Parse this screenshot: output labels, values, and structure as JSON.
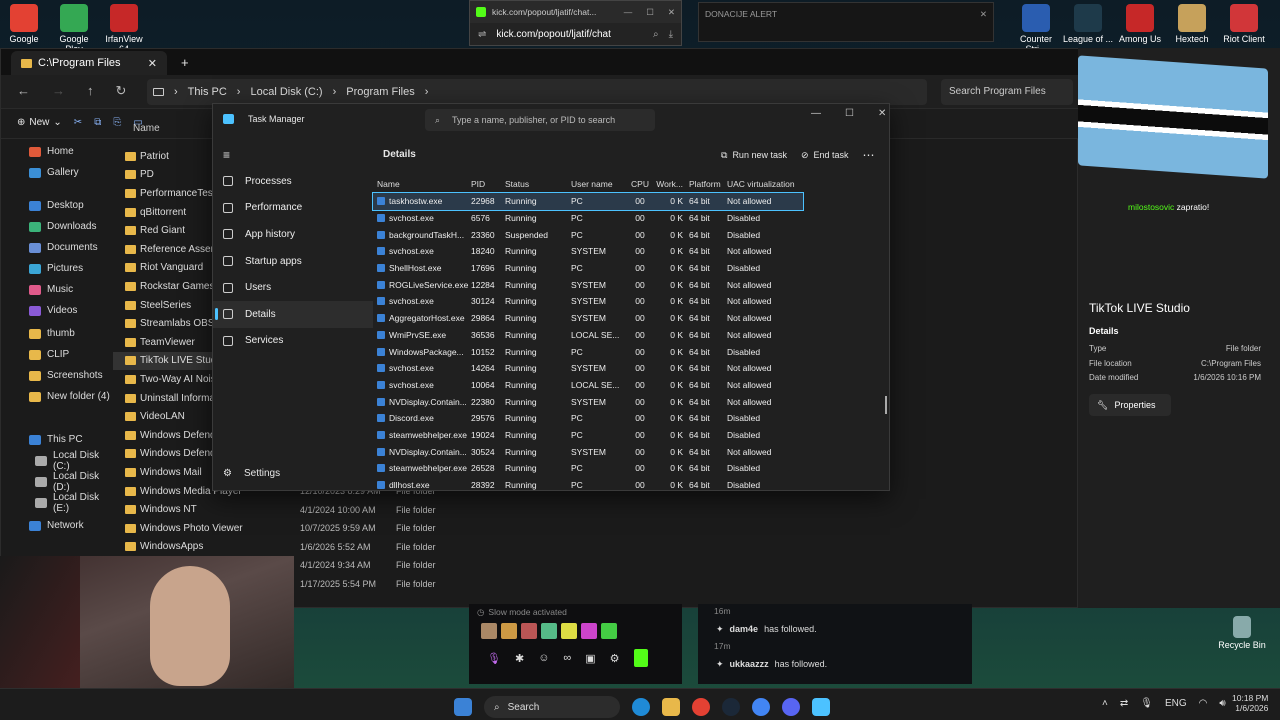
{
  "desktop_icons_left": [
    {
      "label": "Google",
      "color": "#e34133"
    },
    {
      "label": "Google Play",
      "color": "#34a853"
    },
    {
      "label": "IrfanView 64",
      "color": "#c62828"
    }
  ],
  "desktop_icons_right": [
    {
      "label": "Counter Stri...",
      "color": "#2a5db0"
    },
    {
      "label": "League of ...",
      "color": "#1e3a4a"
    },
    {
      "label": "Among Us",
      "color": "#c62828"
    },
    {
      "label": "Hextech",
      "color": "#c6a15b"
    },
    {
      "label": "Riot Client",
      "color": "#d13639"
    }
  ],
  "recycle_bin": {
    "label": "Recycle Bin"
  },
  "chat_popout": {
    "title": "kick.com/popout/ljatif/chat...",
    "url": "kick.com/popout/ljatif/chat"
  },
  "donation_alert": {
    "title": "DONACIJE ALERT"
  },
  "explorer": {
    "tab_title": "C:\\Program Files",
    "breadcrumbs": [
      "This PC",
      "Local Disk (C:)",
      "Program Files"
    ],
    "search_placeholder": "Search Program Files",
    "new_label": "New",
    "column_name": "Name",
    "nav": [
      {
        "label": "Home",
        "color": "#e05a3a"
      },
      {
        "label": "Gallery",
        "color": "#3b8fd6"
      },
      {
        "label": "Desktop",
        "color": "#3b82d6"
      },
      {
        "label": "Downloads",
        "color": "#3bb37a"
      },
      {
        "label": "Documents",
        "color": "#6a8fd6"
      },
      {
        "label": "Pictures",
        "color": "#3ba6d6"
      },
      {
        "label": "Music",
        "color": "#e05a8a"
      },
      {
        "label": "Videos",
        "color": "#8a5ad6"
      },
      {
        "label": "thumb",
        "color": "#e8b84a"
      },
      {
        "label": "CLIP",
        "color": "#e8b84a"
      },
      {
        "label": "Screenshots",
        "color": "#e8b84a"
      },
      {
        "label": "New folder (4)",
        "color": "#e8b84a"
      },
      {
        "label": "This PC",
        "color": "#3b82d6"
      },
      {
        "label": "Local Disk (C:)",
        "color": "#aaaaaa"
      },
      {
        "label": "Local Disk (D:)",
        "color": "#aaaaaa"
      },
      {
        "label": "Local Disk (E:)",
        "color": "#aaaaaa"
      },
      {
        "label": "Network",
        "color": "#3b82d6"
      }
    ],
    "folders": [
      {
        "name": "Patriot",
        "date": "",
        "type": ""
      },
      {
        "name": "PD",
        "date": "",
        "type": ""
      },
      {
        "name": "PerformanceTest",
        "date": "",
        "type": ""
      },
      {
        "name": "qBittorrent",
        "date": "",
        "type": ""
      },
      {
        "name": "Red Giant",
        "date": "",
        "type": ""
      },
      {
        "name": "Reference Assemblie",
        "date": "",
        "type": ""
      },
      {
        "name": "Riot Vanguard",
        "date": "",
        "type": ""
      },
      {
        "name": "Rockstar Games",
        "date": "",
        "type": ""
      },
      {
        "name": "SteelSeries",
        "date": "",
        "type": ""
      },
      {
        "name": "Streamlabs OBS",
        "date": "",
        "type": ""
      },
      {
        "name": "TeamViewer",
        "date": "",
        "type": ""
      },
      {
        "name": "TikTok LIVE Studio",
        "date": "",
        "type": ""
      },
      {
        "name": "Two-Way AI Noise C",
        "date": "",
        "type": ""
      },
      {
        "name": "Uninstall Information",
        "date": "",
        "type": ""
      },
      {
        "name": "VideoLAN",
        "date": "",
        "type": ""
      },
      {
        "name": "Windows Defender",
        "date": "",
        "type": ""
      },
      {
        "name": "Windows Defender A",
        "date": "",
        "type": ""
      },
      {
        "name": "Windows Mail",
        "date": "",
        "type": ""
      },
      {
        "name": "Windows Media Player",
        "date": "12/10/2023 8:29 AM",
        "type": "File folder"
      },
      {
        "name": "Windows NT",
        "date": "4/1/2024 10:00 AM",
        "type": "File folder"
      },
      {
        "name": "Windows Photo Viewer",
        "date": "10/7/2025 9:59 AM",
        "type": "File folder"
      },
      {
        "name": "WindowsApps",
        "date": "1/6/2026 5:52 AM",
        "type": "File folder"
      },
      {
        "name": "",
        "date": "4/1/2024 9:34 AM",
        "type": "File folder"
      },
      {
        "name": "",
        "date": "1/17/2025 5:54 PM",
        "type": "File folder"
      }
    ]
  },
  "task_manager": {
    "title": "Task Manager",
    "search_placeholder": "Type a name, publisher, or PID to search",
    "section_title": "Details",
    "run_new_task": "Run new task",
    "end_task": "End task",
    "nav": [
      {
        "label": "Processes",
        "selected": false
      },
      {
        "label": "Performance",
        "selected": false
      },
      {
        "label": "App history",
        "selected": false
      },
      {
        "label": "Startup apps",
        "selected": false
      },
      {
        "label": "Users",
        "selected": false
      },
      {
        "label": "Details",
        "selected": true
      },
      {
        "label": "Services",
        "selected": false
      }
    ],
    "settings": "Settings",
    "columns": [
      "Name",
      "PID",
      "Status",
      "User name",
      "CPU",
      "Work...",
      "Platform",
      "UAC virtualization"
    ],
    "rows": [
      [
        "taskhostw.exe",
        "22968",
        "Running",
        "PC",
        "00",
        "0 K",
        "64 bit",
        "Not allowed"
      ],
      [
        "svchost.exe",
        "6576",
        "Running",
        "PC",
        "00",
        "0 K",
        "64 bit",
        "Disabled"
      ],
      [
        "backgroundTaskH...",
        "23360",
        "Suspended",
        "PC",
        "00",
        "0 K",
        "64 bit",
        "Disabled"
      ],
      [
        "svchost.exe",
        "18240",
        "Running",
        "SYSTEM",
        "00",
        "0 K",
        "64 bit",
        "Not allowed"
      ],
      [
        "ShellHost.exe",
        "17696",
        "Running",
        "PC",
        "00",
        "0 K",
        "64 bit",
        "Disabled"
      ],
      [
        "ROGLiveService.exe",
        "12284",
        "Running",
        "SYSTEM",
        "00",
        "0 K",
        "64 bit",
        "Not allowed"
      ],
      [
        "svchost.exe",
        "30124",
        "Running",
        "SYSTEM",
        "00",
        "0 K",
        "64 bit",
        "Not allowed"
      ],
      [
        "AggregatorHost.exe",
        "29864",
        "Running",
        "SYSTEM",
        "00",
        "0 K",
        "64 bit",
        "Not allowed"
      ],
      [
        "WmiPrvSE.exe",
        "36536",
        "Running",
        "LOCAL SE...",
        "00",
        "0 K",
        "64 bit",
        "Not allowed"
      ],
      [
        "WindowsPackage...",
        "10152",
        "Running",
        "PC",
        "00",
        "0 K",
        "64 bit",
        "Disabled"
      ],
      [
        "svchost.exe",
        "14264",
        "Running",
        "SYSTEM",
        "00",
        "0 K",
        "64 bit",
        "Not allowed"
      ],
      [
        "svchost.exe",
        "10064",
        "Running",
        "LOCAL SE...",
        "00",
        "0 K",
        "64 bit",
        "Not allowed"
      ],
      [
        "NVDisplay.Contain...",
        "22380",
        "Running",
        "SYSTEM",
        "00",
        "0 K",
        "64 bit",
        "Not allowed"
      ],
      [
        "Discord.exe",
        "29576",
        "Running",
        "PC",
        "00",
        "0 K",
        "64 bit",
        "Disabled"
      ],
      [
        "steamwebhelper.exe",
        "19024",
        "Running",
        "PC",
        "00",
        "0 K",
        "64 bit",
        "Disabled"
      ],
      [
        "NVDisplay.Contain...",
        "30524",
        "Running",
        "SYSTEM",
        "00",
        "0 K",
        "64 bit",
        "Not allowed"
      ],
      [
        "steamwebhelper.exe",
        "26528",
        "Running",
        "PC",
        "00",
        "0 K",
        "64 bit",
        "Disabled"
      ],
      [
        "dllhost.exe",
        "28392",
        "Running",
        "PC",
        "00",
        "0 K",
        "64 bit",
        "Disabled"
      ]
    ]
  },
  "details_panel": {
    "title": "TikTok LIVE Studio",
    "section": "Details",
    "fields": [
      {
        "label": "Type",
        "value": "File folder"
      },
      {
        "label": "File location",
        "value": "C:\\Program Files"
      },
      {
        "label": "Date modified",
        "value": "1/6/2026 10:16 PM"
      }
    ],
    "properties_button": "Properties",
    "chat_user": "milostosovic",
    "chat_text": "zapratio!"
  },
  "stream_chat": {
    "slow_mode": "Slow mode activated",
    "followers": [
      {
        "name": "dam4e",
        "text": "has followed.",
        "ago": "17m"
      },
      {
        "name": "ukkaazzz",
        "text": "has followed.",
        "ago": ""
      }
    ],
    "top_ago": "16m"
  },
  "taskbar": {
    "search_label": "Search",
    "lang": "ENG",
    "time": "10:18 PM",
    "date": "1/6/2026"
  }
}
